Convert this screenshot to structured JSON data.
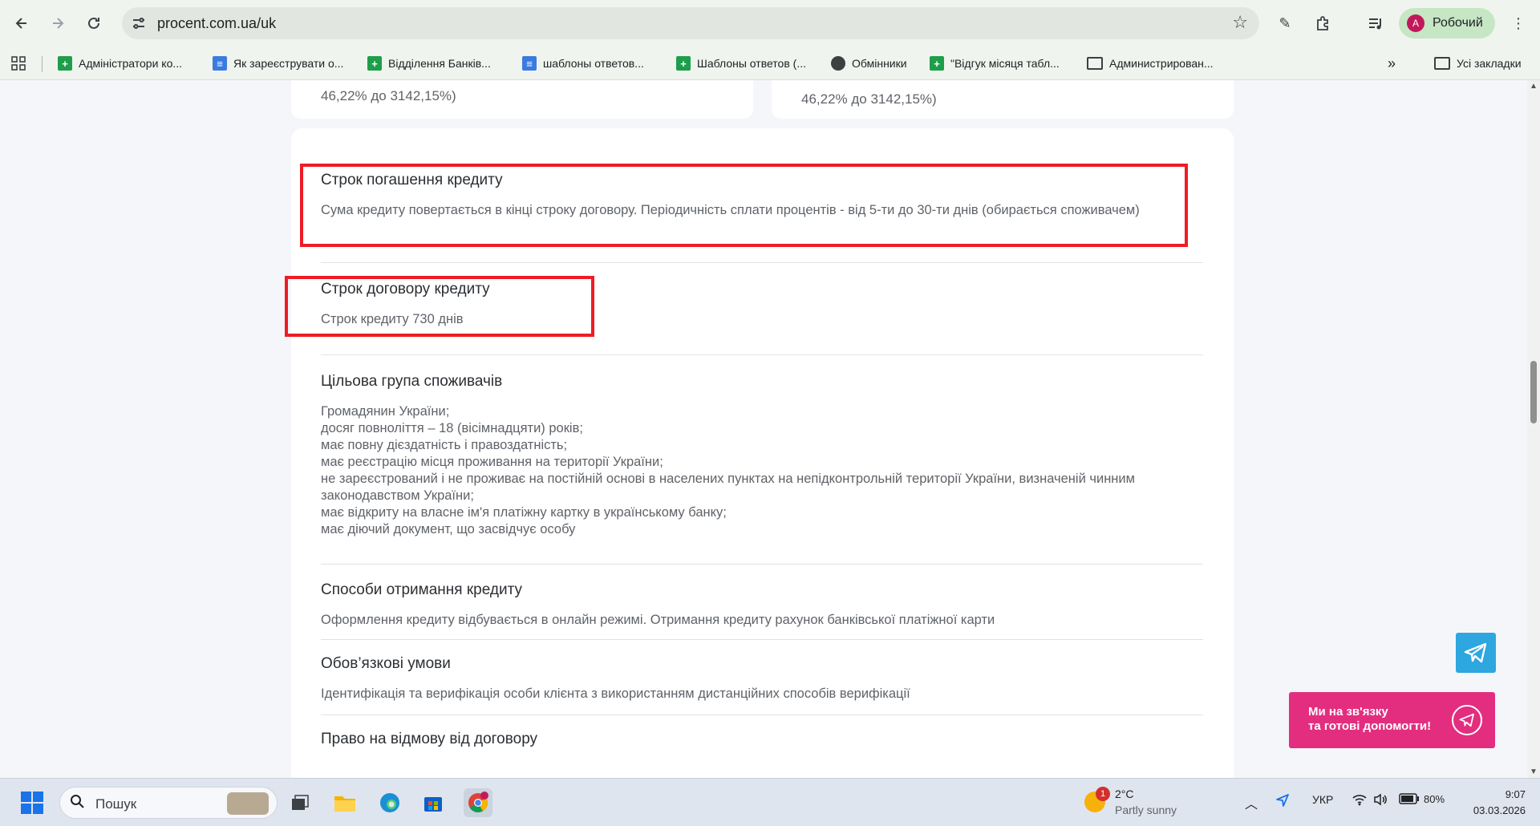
{
  "browser": {
    "url": "procent.com.ua/uk",
    "profile_initial": "A",
    "profile_name": "Робочий",
    "bookmarks": [
      {
        "label": "Адміністратори ко...",
        "icon": "sheet"
      },
      {
        "label": "Як зареєструвати о...",
        "icon": "doc"
      },
      {
        "label": "Відділення Банків...",
        "icon": "sheet"
      },
      {
        "label": "шаблоны ответов...",
        "icon": "doc"
      },
      {
        "label": "Шаблоны ответов (...",
        "icon": "sheet"
      },
      {
        "label": "Обмінники",
        "icon": "globe"
      },
      {
        "label": "\"Відгук місяця табл...",
        "icon": "sheet"
      },
      {
        "label": "Администрирован...",
        "icon": "folder"
      }
    ],
    "more_bookmarks": "»",
    "all_bookmarks": "Усі закладки"
  },
  "page": {
    "top_cards": [
      "46,22% до 3142,15%)",
      "46,22% до 3142,15%)"
    ],
    "sections": [
      {
        "title": "Строк погашення кредиту",
        "body": "Сума кредиту повертається в кінці строку договору. Періодичність сплати процентів - від 5-ти до 30-ти днів (обирається споживачем)"
      },
      {
        "title": "Строк договору кредиту",
        "body": "Строк кредиту 730 днів"
      },
      {
        "title": "Цільова група споживачів",
        "lines": [
          "Громадянин України;",
          "досяг повноліття – 18 (вісімнадцяти) років;",
          "має повну дієздатність і правоздатність;",
          "має реєстрацію місця проживання на території України;",
          "не зареєстрований і не проживає на постійній основі в населених пунктах на непідконтрольній території України, визначеній чинним законодавством України;",
          "має відкриту на власне ім'я платіжну картку в українському банку;",
          "має діючий документ, що засвідчує особу"
        ]
      },
      {
        "title": "Способи отримання кредиту",
        "body": "Оформлення кредиту відбувається в онлайн режимі. Отримання кредиту рахунок банківської платіжної карти"
      },
      {
        "title": "Обов’язкові умови",
        "body": "Ідентифікація та верифікація особи клієнта з використанням дистанційних способів верифікації"
      },
      {
        "title": "Право на відмову від договору"
      }
    ],
    "contact_widget": {
      "line1": "Ми на зв'язку",
      "line2": "та готові допомогти!"
    }
  },
  "taskbar": {
    "search_placeholder": "Пошук",
    "weather_temp": "2°C",
    "weather_desc": "Partly sunny",
    "weather_badge": "1",
    "language": "УКР",
    "battery": "80%",
    "time": "9:07",
    "date": "03.03.2026"
  },
  "colors": {
    "highlight_box": "#ee1c25",
    "contact_bg": "#e32e7f",
    "telegram": "#2ea6e0"
  }
}
